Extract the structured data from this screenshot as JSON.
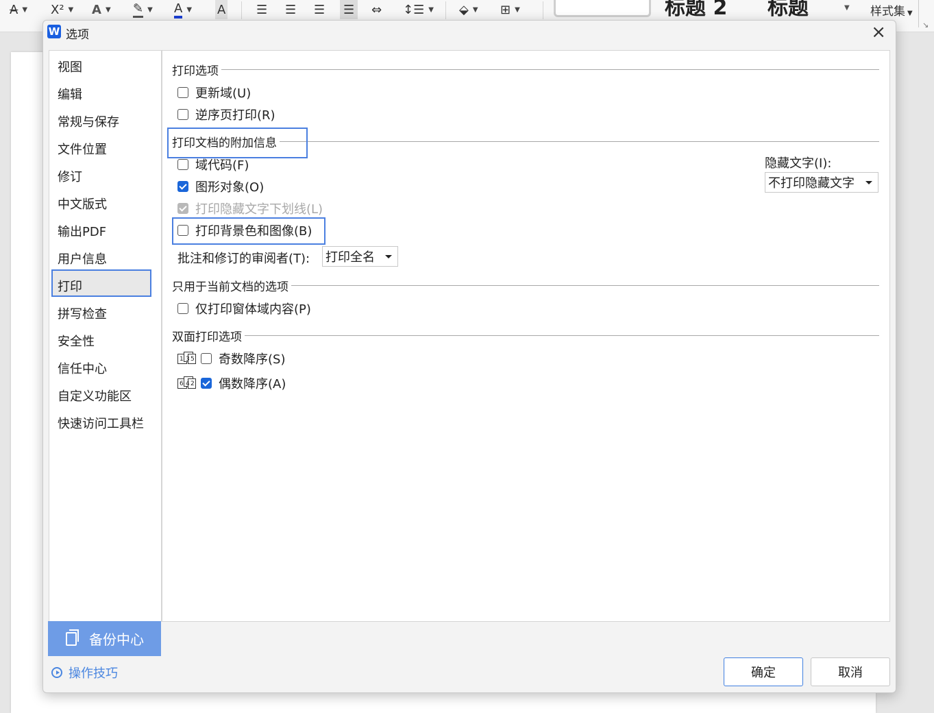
{
  "ribbon": {
    "superscript_label": "X²",
    "style_set_label": "样式集",
    "heading_fragments": [
      "标题 2",
      "标题"
    ]
  },
  "dialog": {
    "logo": "W",
    "title": "选项",
    "close": "×"
  },
  "nav": {
    "items": [
      "视图",
      "编辑",
      "常规与保存",
      "文件位置",
      "修订",
      "中文版式",
      "输出PDF",
      "用户信息",
      "打印",
      "拼写检查",
      "安全性",
      "信任中心",
      "自定义功能区",
      "快速访问工具栏"
    ],
    "selected": "打印",
    "backup_label": "备份中心",
    "tips_label": "操作技巧"
  },
  "print_options": {
    "title": "打印选项",
    "update_fields": {
      "label": "更新域(U)",
      "checked": false
    },
    "reverse_order": {
      "label": "逆序页打印(R)",
      "checked": false
    }
  },
  "extra_info": {
    "title": "打印文档的附加信息",
    "field_codes": {
      "label": "域代码(F)",
      "checked": false
    },
    "drawing_objects": {
      "label": "图形对象(O)",
      "checked": true
    },
    "hidden_underline": {
      "label": "打印隐藏文字下划线(L)",
      "checked": true,
      "disabled": true
    },
    "background": {
      "label": "打印背景色和图像(B)",
      "checked": false
    },
    "reviewer_label": "批注和修订的审阅者(T):",
    "reviewer_value": "打印全名",
    "hidden_text_label": "隐藏文字(I):",
    "hidden_text_value": "不打印隐藏文字"
  },
  "current_doc": {
    "title": "只用于当前文档的选项",
    "form_only": {
      "label": "仅打印窗体域内容(P)",
      "checked": false
    }
  },
  "duplex": {
    "title": "双面打印选项",
    "odd_desc": {
      "label": "奇数降序(S)",
      "checked": false,
      "icon_digits": [
        "1",
        "3",
        "5"
      ]
    },
    "even_desc": {
      "label": "偶数降序(A)",
      "checked": true,
      "icon_digits": [
        "6",
        "4",
        "2"
      ]
    }
  },
  "buttons": {
    "ok": "确定",
    "cancel": "取消"
  },
  "colors": {
    "accent": "#1a66d9",
    "highlight": "#4a7fe0",
    "backup_bg": "#6e9ce6"
  }
}
